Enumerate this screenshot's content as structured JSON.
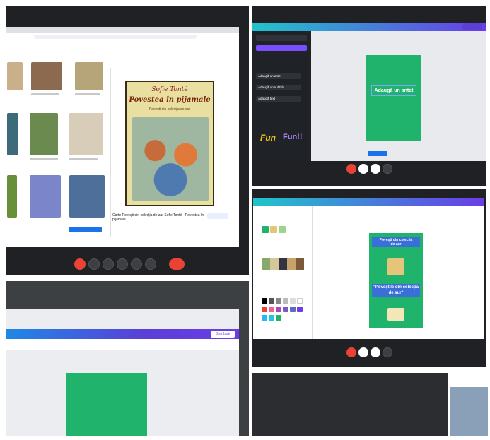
{
  "panels": {
    "top_left": {
      "book": {
        "author": "Sofie Tonté",
        "title": "Povestea în pijamale",
        "subtitle": "Povești din colecția de aur"
      },
      "results_caption": "Carte Povești din colecția de aur Sofie Tonté - Povestea în pijamale"
    },
    "top_right": {
      "canvas_text": "Adaugă un antet",
      "sidebar_items": [
        "Adaugă un antet",
        "Adaugă un subtitlu",
        "Adaugă text"
      ],
      "fonts": [
        "Fun",
        "Fun!!"
      ]
    },
    "bottom_right": {
      "poster_lines": [
        "Povești din colecția",
        "de aur"
      ],
      "poster_footer": "\"Poveștile din colecția de aur\""
    },
    "bottom_left": {
      "publish_label": "Distribuie"
    }
  },
  "colors": {
    "canva_green": "#1fb36b",
    "meet_red": "#ea4335",
    "canva_purple": "#6a3de8",
    "dark_bg": "#202124"
  },
  "icons": [
    "mic-icon",
    "camera-icon",
    "present-icon",
    "hand-icon",
    "hangup-icon"
  ]
}
